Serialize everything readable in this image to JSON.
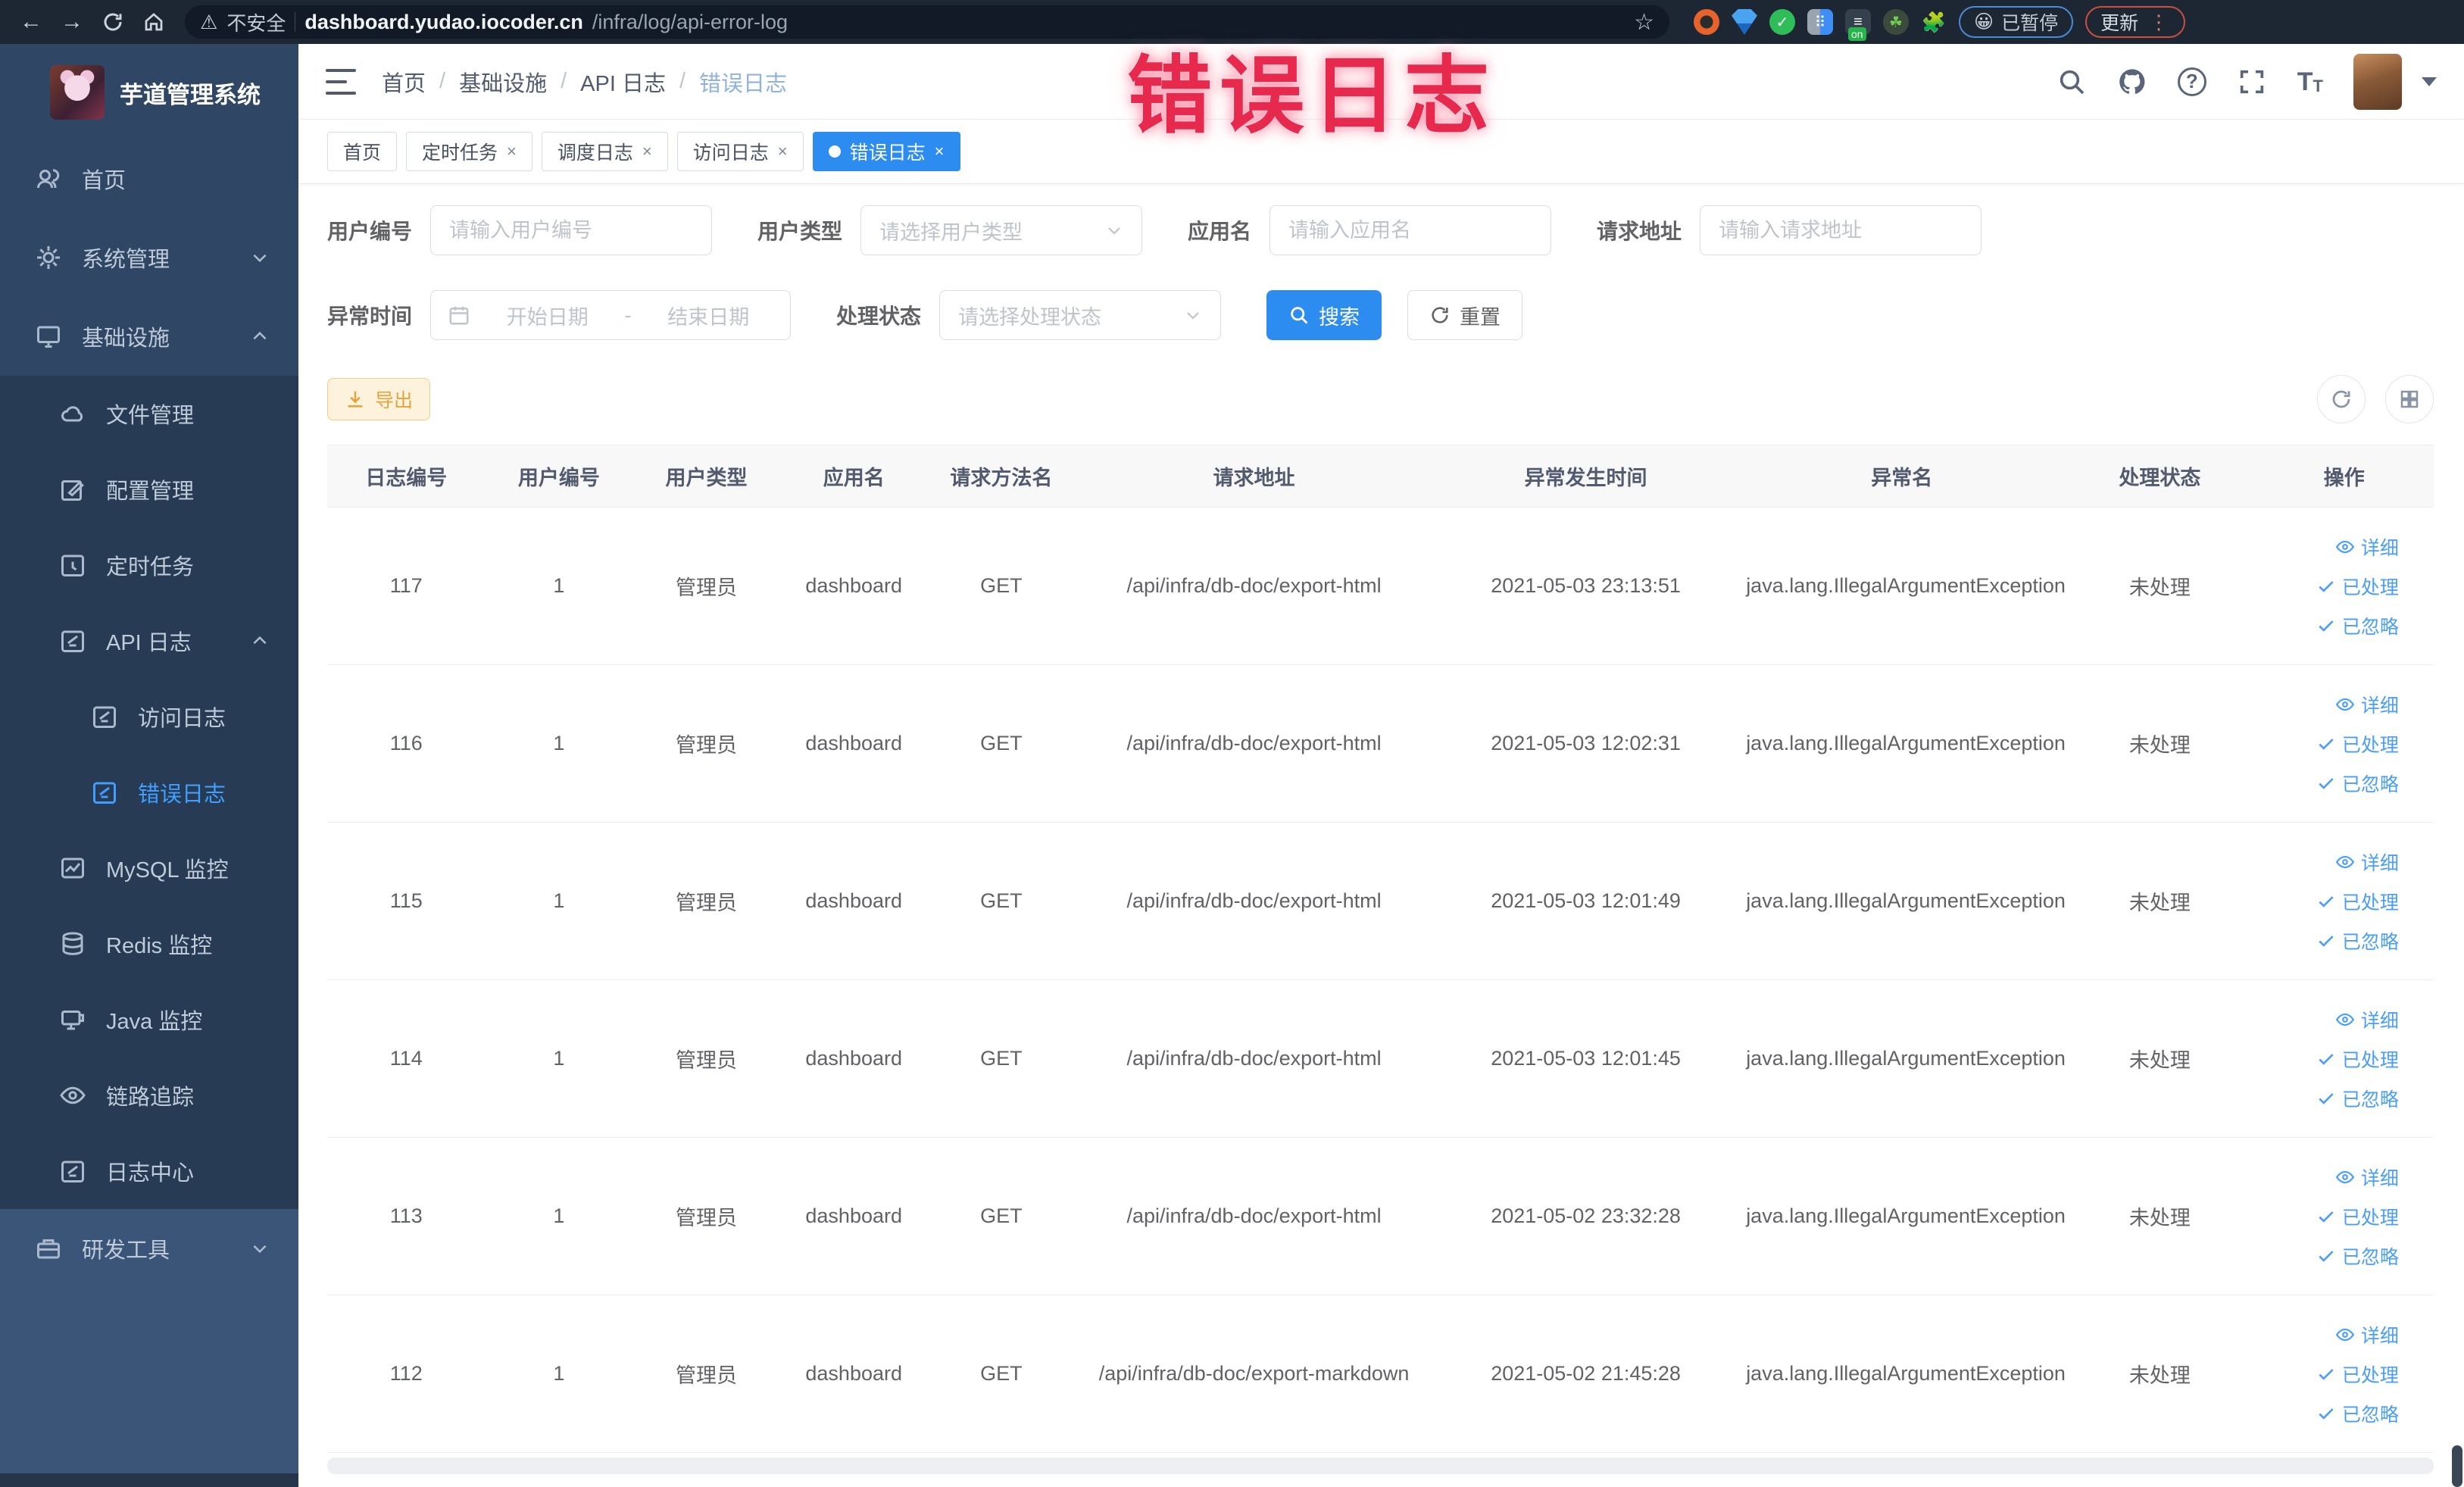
{
  "overlay": {
    "title": "错误日志"
  },
  "browser": {
    "security_label": "不安全",
    "url_host": "dashboard.yudao.iocoder.cn",
    "url_path": "/infra/log/api-error-log",
    "ext_badge_text": "on",
    "paused_label": "已暂停",
    "paused_emoji": "😀",
    "update_label": "更新"
  },
  "sidebar": {
    "app_title": "芋道管理系统",
    "items": [
      {
        "label": "首页"
      },
      {
        "label": "系统管理"
      },
      {
        "label": "基础设施"
      },
      {
        "label": "文件管理"
      },
      {
        "label": "配置管理"
      },
      {
        "label": "定时任务"
      },
      {
        "label": "API 日志"
      },
      {
        "label": "访问日志"
      },
      {
        "label": "错误日志"
      },
      {
        "label": "MySQL 监控"
      },
      {
        "label": "Redis 监控"
      },
      {
        "label": "Java 监控"
      },
      {
        "label": "链路追踪"
      },
      {
        "label": "日志中心"
      },
      {
        "label": "研发工具"
      }
    ]
  },
  "header": {
    "breadcrumbs": [
      "首页",
      "基础设施",
      "API 日志",
      "错误日志"
    ]
  },
  "tags": [
    {
      "label": "首页"
    },
    {
      "label": "定时任务"
    },
    {
      "label": "调度日志"
    },
    {
      "label": "访问日志"
    },
    {
      "label": "错误日志"
    }
  ],
  "filters": {
    "user_id_label": "用户编号",
    "user_id_placeholder": "请输入用户编号",
    "user_type_label": "用户类型",
    "user_type_placeholder": "请选择用户类型",
    "app_name_label": "应用名",
    "app_name_placeholder": "请输入应用名",
    "request_url_label": "请求地址",
    "request_url_placeholder": "请输入请求地址",
    "exception_time_label": "异常时间",
    "date_start_placeholder": "开始日期",
    "date_separator": "-",
    "date_end_placeholder": "结束日期",
    "process_status_label": "处理状态",
    "process_status_placeholder": "请选择处理状态",
    "search_label": "搜索",
    "reset_label": "重置"
  },
  "toolbar": {
    "export_label": "导出"
  },
  "table": {
    "headers": [
      "日志编号",
      "用户编号",
      "用户类型",
      "应用名",
      "请求方法名",
      "请求地址",
      "异常发生时间",
      "异常名",
      "处理状态",
      "操作"
    ],
    "row_actions": {
      "detail": "详细",
      "processed": "已处理",
      "ignored": "已忽略"
    },
    "rows": [
      {
        "log_id": "117",
        "user_id": "1",
        "user_type": "管理员",
        "app_name": "dashboard",
        "method": "GET",
        "url": "/api/infra/db-doc/export-html",
        "time": "2021-05-03 23:13:51",
        "exception": "java.lang.IllegalArgumentException",
        "status": "未处理"
      },
      {
        "log_id": "116",
        "user_id": "1",
        "user_type": "管理员",
        "app_name": "dashboard",
        "method": "GET",
        "url": "/api/infra/db-doc/export-html",
        "time": "2021-05-03 12:02:31",
        "exception": "java.lang.IllegalArgumentException",
        "status": "未处理"
      },
      {
        "log_id": "115",
        "user_id": "1",
        "user_type": "管理员",
        "app_name": "dashboard",
        "method": "GET",
        "url": "/api/infra/db-doc/export-html",
        "time": "2021-05-03 12:01:49",
        "exception": "java.lang.IllegalArgumentException",
        "status": "未处理"
      },
      {
        "log_id": "114",
        "user_id": "1",
        "user_type": "管理员",
        "app_name": "dashboard",
        "method": "GET",
        "url": "/api/infra/db-doc/export-html",
        "time": "2021-05-03 12:01:45",
        "exception": "java.lang.IllegalArgumentException",
        "status": "未处理"
      },
      {
        "log_id": "113",
        "user_id": "1",
        "user_type": "管理员",
        "app_name": "dashboard",
        "method": "GET",
        "url": "/api/infra/db-doc/export-html",
        "time": "2021-05-02 23:32:28",
        "exception": "java.lang.IllegalArgumentException",
        "status": "未处理"
      },
      {
        "log_id": "112",
        "user_id": "1",
        "user_type": "管理员",
        "app_name": "dashboard",
        "method": "GET",
        "url": "/api/infra/db-doc/export-markdown",
        "time": "2021-05-02 21:45:28",
        "exception": "java.lang.IllegalArgumentException",
        "status": "未处理"
      }
    ]
  }
}
